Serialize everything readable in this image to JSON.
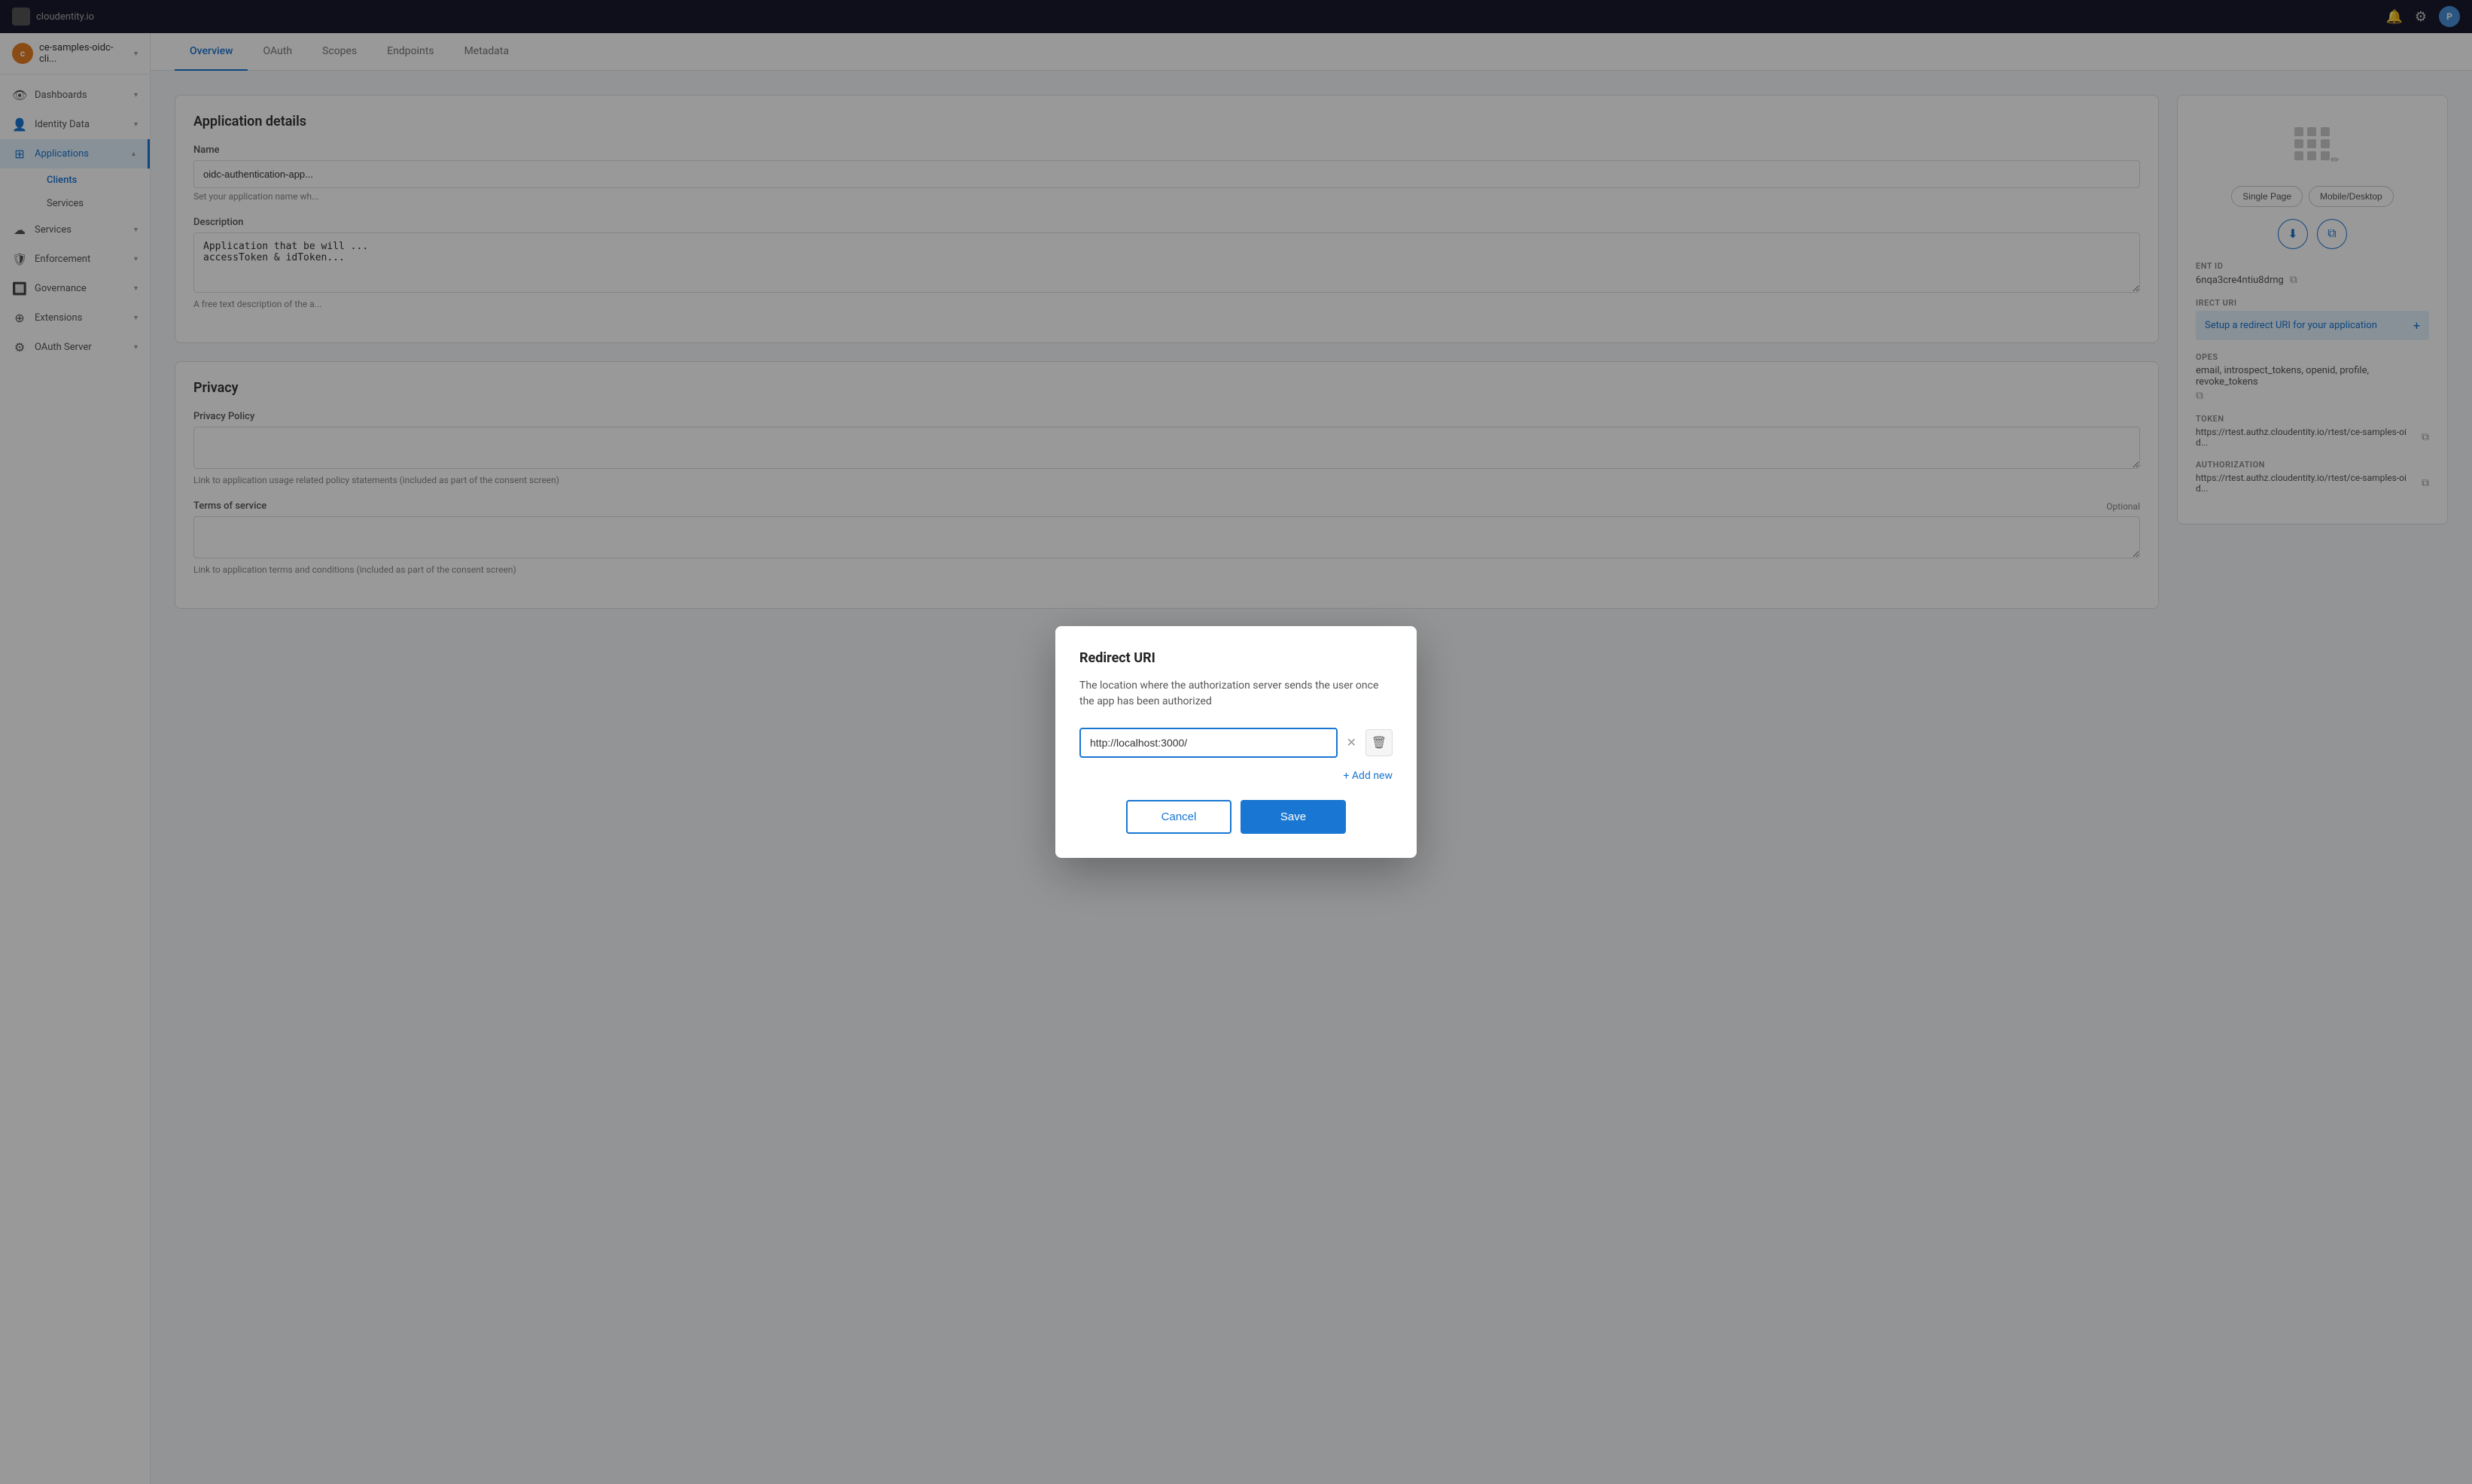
{
  "topbar": {
    "title": "cloudentity.io",
    "avatar_label": "P"
  },
  "sidebar": {
    "org_name": "ce-samples-oidc-cli...",
    "org_avatar": "c",
    "items": [
      {
        "id": "dashboards",
        "label": "Dashboards",
        "icon": "👁",
        "active": false,
        "expandable": true
      },
      {
        "id": "identity-data",
        "label": "Identity Data",
        "icon": "👤",
        "active": false,
        "expandable": true
      },
      {
        "id": "applications",
        "label": "Applications",
        "icon": "⊞",
        "active": true,
        "expandable": true
      },
      {
        "id": "services",
        "label": "Services",
        "icon": "☁",
        "active": false,
        "expandable": true
      },
      {
        "id": "enforcement",
        "label": "Enforcement",
        "icon": "🛡",
        "active": false,
        "expandable": true
      },
      {
        "id": "governance",
        "label": "Governance",
        "icon": "🔲",
        "active": false,
        "expandable": true
      },
      {
        "id": "extensions",
        "label": "Extensions",
        "icon": "⊕",
        "active": false,
        "expandable": true
      },
      {
        "id": "oauth-server",
        "label": "OAuth Server",
        "icon": "⚙",
        "active": false,
        "expandable": true
      }
    ],
    "sub_items": [
      {
        "id": "clients",
        "label": "Clients",
        "active": true
      },
      {
        "id": "services",
        "label": "Services",
        "active": false
      }
    ]
  },
  "tabs": [
    {
      "id": "overview",
      "label": "Overview",
      "active": true
    },
    {
      "id": "oauth",
      "label": "OAuth",
      "active": false
    },
    {
      "id": "scopes",
      "label": "Scopes",
      "active": false
    },
    {
      "id": "endpoints",
      "label": "Endpoints",
      "active": false
    },
    {
      "id": "metadata",
      "label": "Metadata",
      "active": false
    }
  ],
  "main": {
    "app_details_title": "Application details",
    "name_label": "Name",
    "name_value": "oidc-authentication-app...",
    "name_hint": "Set your application name wh...",
    "description_label": "Description",
    "description_value": "Application that be will ...\naccessToken & idToken...",
    "description_hint": "A free text description of the a...",
    "privacy_title": "Privacy",
    "privacy_policy_label": "Privacy Policy",
    "privacy_policy_hint": "Link to application usage related policy statements (included as part of the consent screen)",
    "terms_label": "Terms of service",
    "terms_badge": "Optional",
    "terms_hint": "Link to application terms and conditions (included as part of the consent screen)"
  },
  "side_panel": {
    "client_id_label": "ENT ID",
    "client_id_value": "6nqa3cre4ntiu8drng",
    "redirect_uri_label": "IRECT URI",
    "redirect_uri_link": "Setup a redirect URI for your application",
    "scopes_label": "OPES",
    "scopes_value": "email, introspect_tokens, openid, profile, revoke_tokens",
    "token_label": "TOKEN",
    "token_value": "https://rtest.authz.cloudentity.io/rtest/ce-samples-oid...",
    "authorization_label": "AUTHORIZATION",
    "authorization_value": "https://rtest.authz.cloudentity.io/rtest/ce-samples-oid...",
    "app_type_single": "Single Page",
    "app_type_mobile": "Mobile/Desktop"
  },
  "modal": {
    "title": "Redirect URI",
    "description": "The location where the authorization server sends the user once the app has been authorized",
    "input_value": "http://localhost:3000/",
    "add_another_label": "+ Add new",
    "cancel_label": "Cancel",
    "save_label": "Save"
  }
}
